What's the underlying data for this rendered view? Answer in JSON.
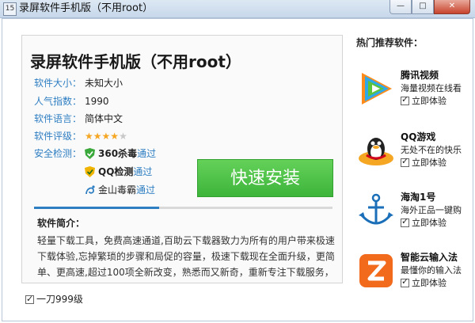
{
  "window": {
    "title": "录屏软件手机版（不用root）",
    "icon_label": "15",
    "buttons": {
      "minimize": "—",
      "maximize": "□",
      "close": "✕"
    }
  },
  "software": {
    "title": "录屏软件手机版（不用root）",
    "info": [
      {
        "label": "软件大小：",
        "value": "未知大小"
      },
      {
        "label": "人气指数：",
        "value": "1990"
      },
      {
        "label": "软件语言：",
        "value": "简体中文"
      },
      {
        "label": "软件评级：",
        "rating": 4,
        "rating_max": 5
      }
    ],
    "security_label": "安全检测：",
    "security": [
      {
        "name": "360杀毒",
        "status": "通过",
        "icon": "shield-green-icon"
      },
      {
        "name": "QQ检测",
        "status": "通过",
        "icon": "shield-yellow-icon"
      },
      {
        "name": "金山毒霸",
        "status": "通过",
        "icon": "kingsoft-icon"
      }
    ],
    "install_button": "快速安装",
    "progress": 0.42,
    "description_title": "软件简介：",
    "description": "轻量下载工具，免费高速通道,百助云下载器致力为所有的用户带来极速下载体验,忘掉繁琐的步骤和局促的容量，极速下载现在全面升级，更简单、更高速,超过100项全新改变，熟悉而又新奇，重新专注下载服务，"
  },
  "footer": {
    "checkbox_label": "一刀999级",
    "checked": true
  },
  "sidebar": {
    "title": "热门推荐软件：",
    "apps": [
      {
        "name": "腾讯视频",
        "subtitle": "海量视频在线看",
        "check_label": "立即体验",
        "icon": "tencent-video-icon"
      },
      {
        "name": "QQ游戏",
        "subtitle": "无处不在的快乐",
        "check_label": "立即体验",
        "icon": "qq-game-icon"
      },
      {
        "name": "海淘1号",
        "subtitle": "海外正品一键购",
        "check_label": "立即体验",
        "icon": "haitao-icon"
      },
      {
        "name": "智能云输入法",
        "subtitle": "最懂你的输入法",
        "check_label": "立即体验",
        "icon": "input-method-icon"
      }
    ]
  },
  "colors": {
    "accent": "#2e7ec2",
    "install": "#4cc048",
    "star": "#f5a623"
  }
}
